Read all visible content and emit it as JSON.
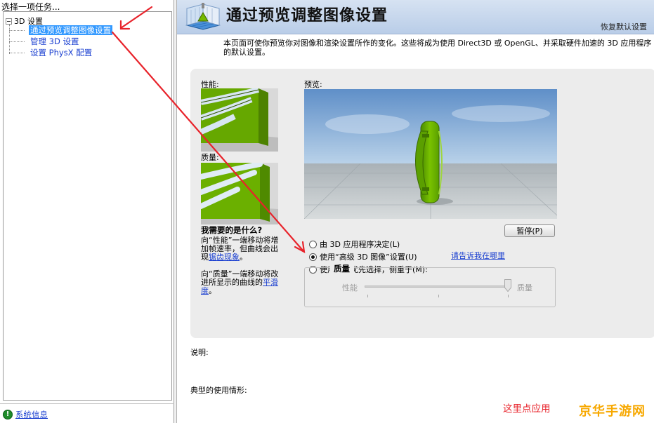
{
  "left": {
    "title": "选择一项任务...",
    "tree": {
      "root": "3D 设置",
      "children": [
        "通过预览调整图像设置",
        "管理 3D 设置",
        "设置 PhysX 配置"
      ],
      "selected_index": 0
    },
    "status_link": "系统信息"
  },
  "header": {
    "title": "通过预览调整图像设置",
    "restore": "恢复默认设置"
  },
  "intro": "本页面可使你预览你对图像和渲染设置所作的变化。这些将成为使用 Direct3D 或 OpenGL、并采取硬件加速的 3D 应用程序的默认设置。",
  "panel": {
    "performance_label": "性能:",
    "quality_label": "质量:",
    "help_title": "我需要的是什么?",
    "help_p1_before": "向“性能”一端移动将增加帧速率，但曲线会出现",
    "help_p1_link": "锯齿现象",
    "help_p1_after": "。",
    "help_p2_before": "向“质量”一端移动将改进所显示的曲线的",
    "help_p2_link": "平滑度",
    "help_p2_after": "。",
    "preview_label": "预览:",
    "pause_button": "暂停(P)",
    "options": [
      "由 3D 应用程序决定(L)",
      "使用“高级 3D 图像”设置(U)",
      "使用我的优先选择，侧重于(M):"
    ],
    "selected_option": 1,
    "where_link": "请告诉我在哪里",
    "group_title": "质量",
    "slider_left": "性能",
    "slider_right": "质量",
    "slider_value": 1.0
  },
  "description_label": "说明:",
  "usage_label": "典型的使用情形:",
  "apply_note": "这里点应用",
  "watermark": "京华手游网",
  "colors": {
    "selected_bg": "#3399ff",
    "link": "#1a3fd0",
    "annotation_red": "#e8232b",
    "nvidia_green": "#76b900",
    "watermark": "#f7a800"
  }
}
